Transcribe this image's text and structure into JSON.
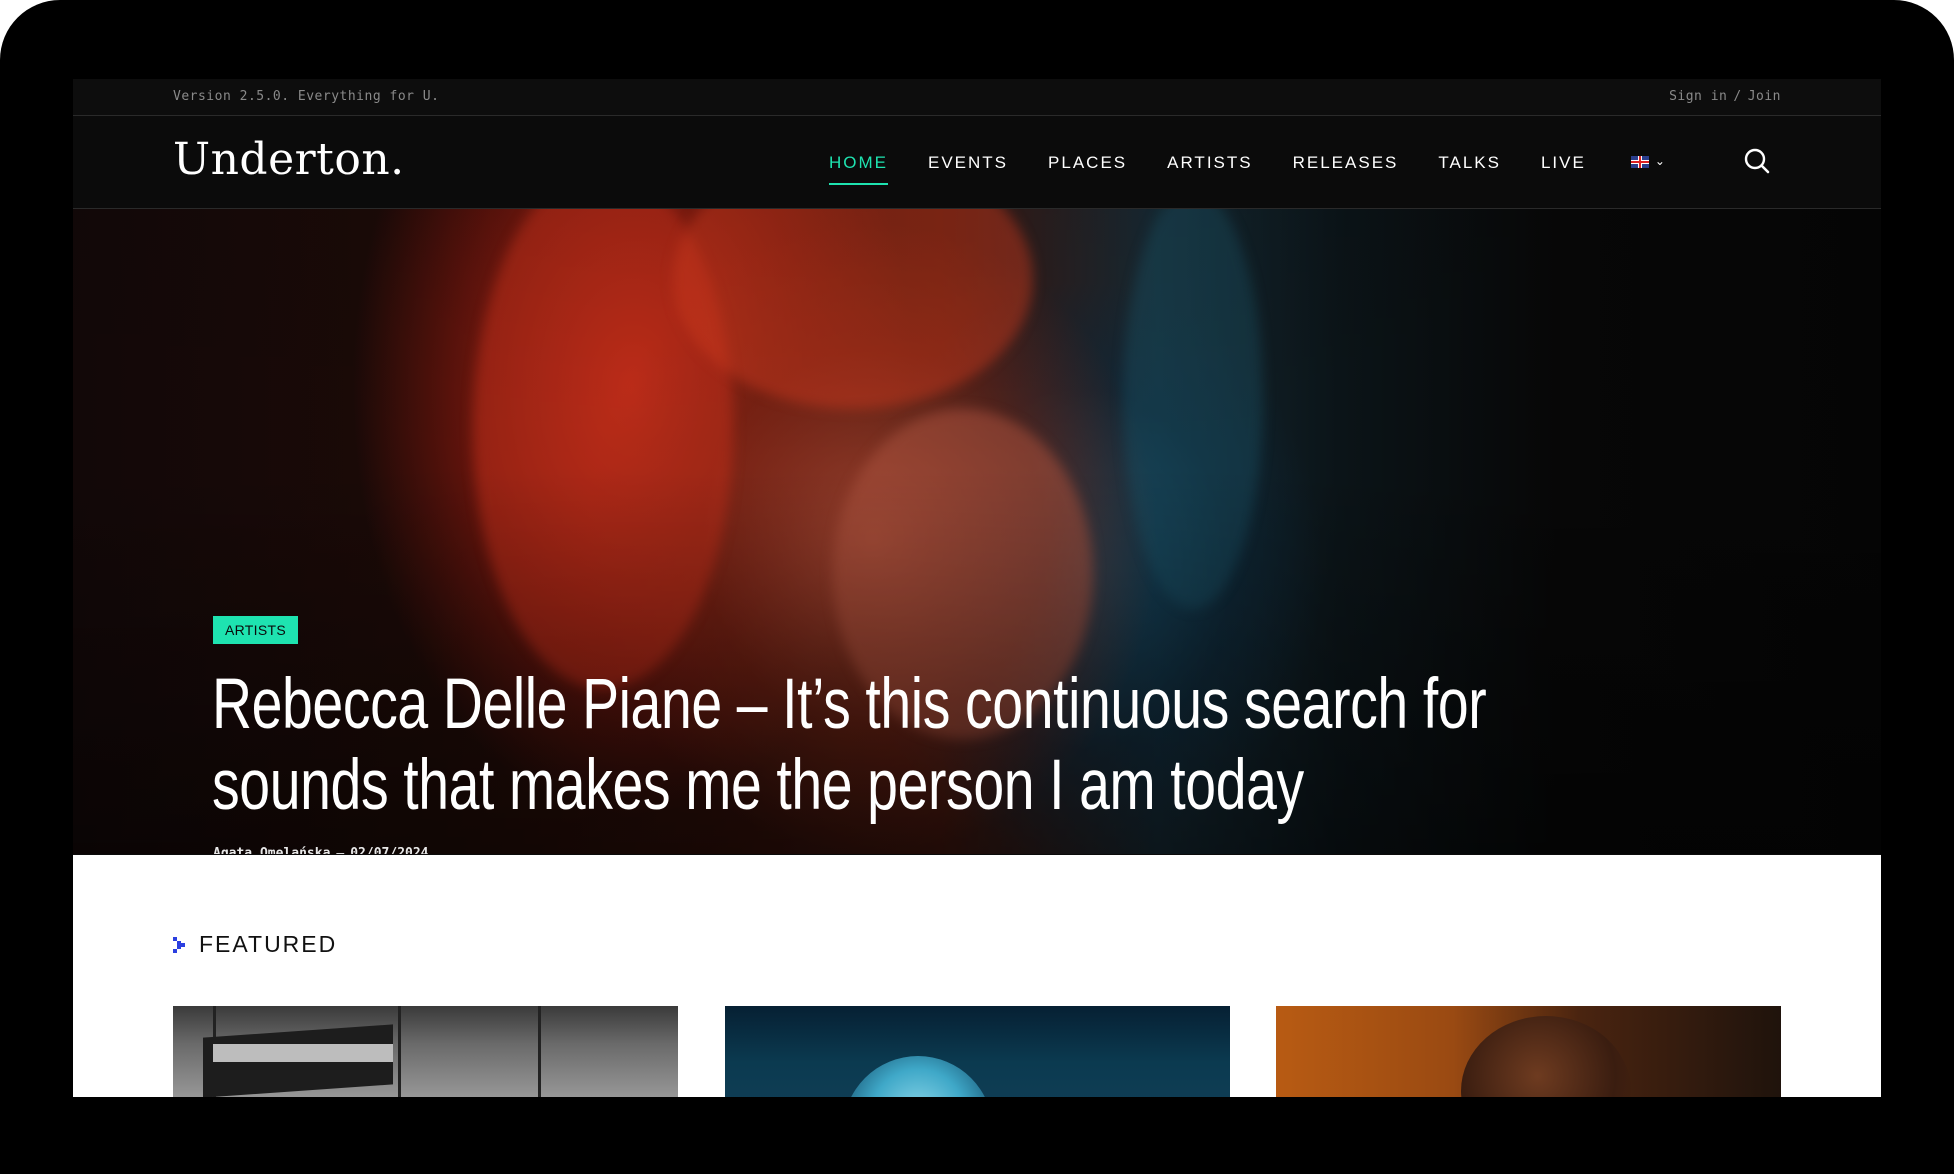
{
  "topbar": {
    "version_text": "Version 2.5.0. Everything for U.",
    "sign_in": "Sign in",
    "separator": "/",
    "join": "Join"
  },
  "header": {
    "logo": "Underton.",
    "nav": [
      {
        "label": "HOME",
        "active": true
      },
      {
        "label": "EVENTS",
        "active": false
      },
      {
        "label": "PLACES",
        "active": false
      },
      {
        "label": "ARTISTS",
        "active": false
      },
      {
        "label": "RELEASES",
        "active": false
      },
      {
        "label": "TALKS",
        "active": false
      },
      {
        "label": "LIVE",
        "active": false
      }
    ],
    "language_icon": "uk-flag-icon",
    "search_icon": "search-icon"
  },
  "hero": {
    "category": "ARTISTS",
    "headline": "Rebecca Delle Piane –  It’s this continuous search for sounds that makes me the person I am today",
    "author": "Agata Omelańska",
    "meta_separator": "–",
    "date": "02/07/2024"
  },
  "featured": {
    "title": "FEATURED"
  },
  "colors": {
    "accent": "#1ee3b0",
    "featured_icon": "#2b3fe0",
    "background_dark": "#0b0b0b"
  }
}
